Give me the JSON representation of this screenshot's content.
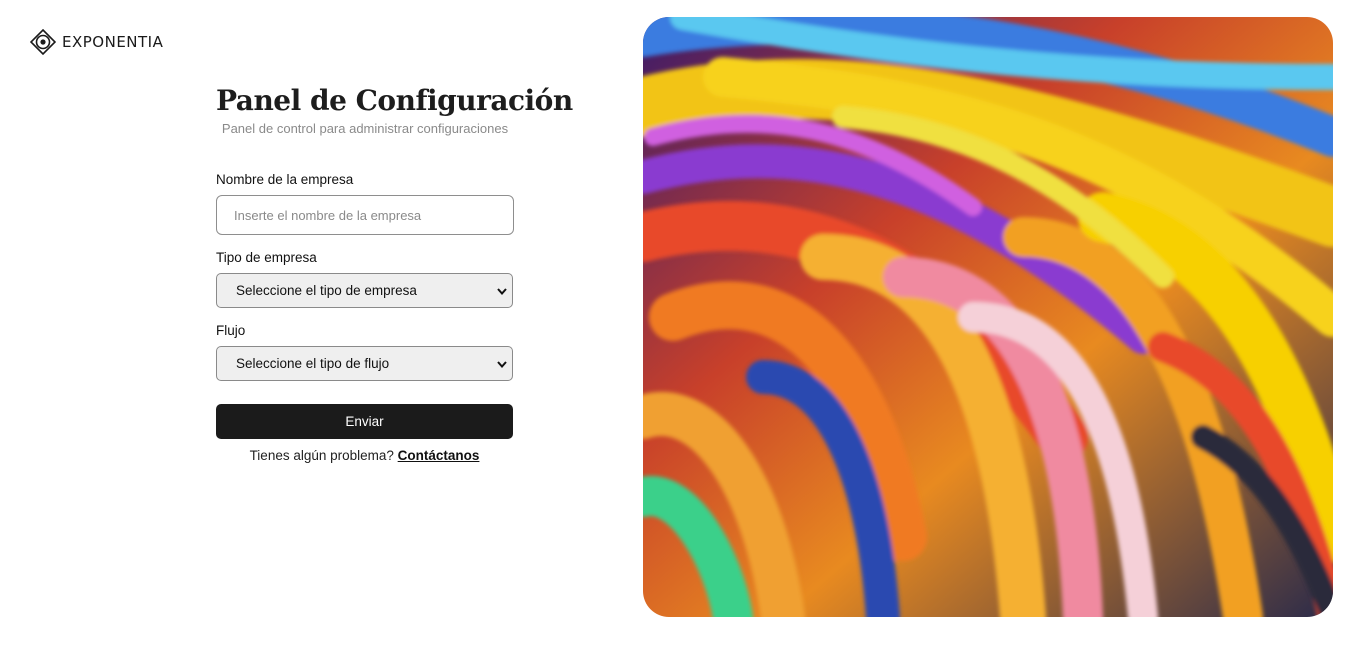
{
  "brand": {
    "name": "EXPONENTIA",
    "logo_icon": "exponentia-logo-icon"
  },
  "header": {
    "title": "Panel de Configuración",
    "subtitle": "Panel de control para administrar configuraciones"
  },
  "form": {
    "company_name": {
      "label": "Nombre de la empresa",
      "placeholder": "Inserte el nombre de la empresa",
      "value": ""
    },
    "company_type": {
      "label": "Tipo de empresa",
      "selected": "Seleccione el tipo de empresa",
      "icon": "chevron-down-icon"
    },
    "flow": {
      "label": "Flujo",
      "selected": "Seleccione el tipo de flujo",
      "icon": "chevron-down-icon"
    },
    "submit_label": "Enviar"
  },
  "help": {
    "text": "Tienes algún problema? ",
    "link_label": "Contáctanos"
  },
  "colors": {
    "button_bg": "#1b1b1b",
    "select_bg": "#efefef",
    "subtitle_gray": "#8a8a8a"
  }
}
